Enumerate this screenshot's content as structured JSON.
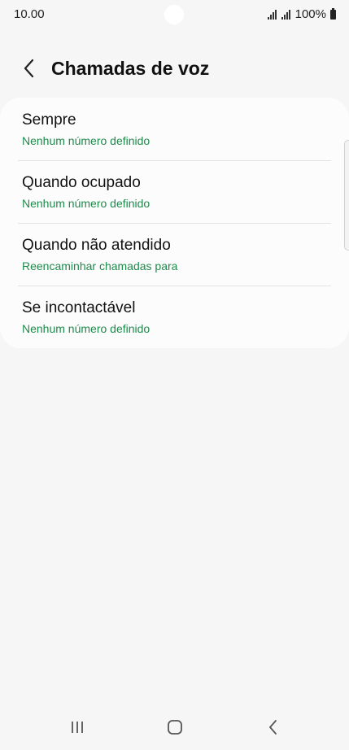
{
  "status_bar": {
    "time": "10.00",
    "battery_text": "100%",
    "icons": [
      "signal-icon",
      "signal-icon",
      "battery-icon"
    ]
  },
  "header": {
    "title": "Chamadas de voz",
    "back_icon": "chevron-left-icon"
  },
  "items": [
    {
      "title": "Sempre",
      "subtitle": "Nenhum número definido"
    },
    {
      "title": "Quando ocupado",
      "subtitle": "Nenhum número definido"
    },
    {
      "title": "Quando não atendido",
      "subtitle": "Reencaminhar chamadas para"
    },
    {
      "title": "Se incontactável",
      "subtitle": "Nenhum número definido"
    }
  ],
  "nav_bar": {
    "icons": [
      "recent-apps-icon",
      "home-icon",
      "back-icon"
    ]
  },
  "colors": {
    "background": "#f6f6f6",
    "card": "#fcfcfc",
    "accent_green": "#1e8a4c"
  }
}
